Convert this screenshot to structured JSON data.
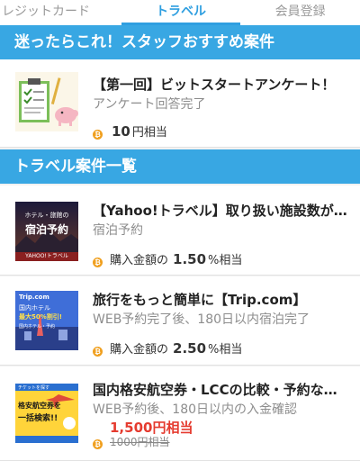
{
  "tabs": [
    {
      "label": "レジットカード",
      "active": false
    },
    {
      "label": "トラベル",
      "active": true
    },
    {
      "label": "会員登録",
      "active": false
    }
  ],
  "staff_section": {
    "title": "迷ったらこれ！スタッフおすすめ案件"
  },
  "staff_items": [
    {
      "title": "【第一回】ビットスタートアンケート！",
      "subtitle": "アンケート回答完了",
      "reward_value": "10",
      "reward_suffix": "円相当"
    }
  ],
  "travel_section": {
    "title": "トラベル案件一覧"
  },
  "travel_items": [
    {
      "title": "【Yahoo!トラベル】取り扱い施設数が…",
      "subtitle": "宿泊予約",
      "reward_prefix": "購入金額の",
      "reward_value": "1.50",
      "reward_suffix": "%相当",
      "thumb": {
        "line1": "ホテル・旅館の",
        "line2": "宿泊予約",
        "brand": "YAHOO!トラベル"
      }
    },
    {
      "title": "旅行をもっと簡単に【Trip.com】",
      "subtitle": "WEB予約完了後、180日以内宿泊完了",
      "reward_prefix": "購入金額の",
      "reward_value": "2.50",
      "reward_suffix": "%相当",
      "thumb": {
        "brand": "Trip.com",
        "line1": "国内ホテル",
        "line2": "最大50%割引!",
        "line3": "国内ホテル・予約"
      }
    },
    {
      "title": "国内格安航空券・LCCの比較・予約な…",
      "subtitle": "WEB予約後、180日以内の入金確認",
      "reward_new": "1,500円相当",
      "reward_old": "1000円相当",
      "thumb": {
        "line1": "格安航空券を",
        "line2": "一括検索!!",
        "line3": "チケットを探す"
      }
    }
  ],
  "colors": {
    "accent": "#2f9fe0",
    "header_bg": "#38a7e3",
    "coin": "#f0a020",
    "sale_red": "#e53b2f"
  },
  "icons": {
    "coin": "bitcoin-coin-icon"
  }
}
